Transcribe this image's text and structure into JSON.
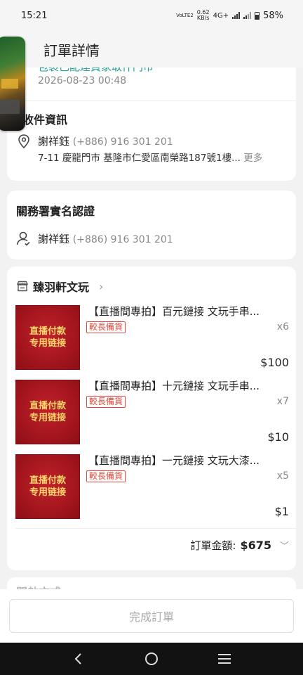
{
  "status_bar": {
    "time": "15:21",
    "speed_top": "0.62",
    "speed_unit": "KB/s",
    "net_small": "VoLTE2",
    "network": "4G+",
    "battery": "58%"
  },
  "header": {
    "title": "訂單詳情"
  },
  "shipping": {
    "status": "包裹已配達買家取件門市",
    "time": "2026-08-23 00:48",
    "section_title": "收件資訊",
    "name": "謝祥鈺",
    "phone": "(+886) 916 301 201",
    "address": "7-11 慶龍門市 基隆市仁愛區南榮路187號1樓...",
    "more": "更多"
  },
  "customs": {
    "title": "關務署實名認證",
    "name": "謝祥鈺",
    "phone": "(+886) 916 301 201"
  },
  "shop": {
    "name": "臻羽軒文玩",
    "items": [
      {
        "thumb_line1": "直播付款",
        "thumb_line2": "专用链接",
        "title": "【直播間專拍】百元鏈接 文玩手串...",
        "tag": "較長備貨",
        "qty": "x6",
        "price": "$100"
      },
      {
        "thumb_line1": "直播付款",
        "thumb_line2": "专用链接",
        "title": "【直播間專拍】十元鏈接 文玩手串...",
        "tag": "較長備貨",
        "qty": "x7",
        "price": "$10"
      },
      {
        "thumb_line1": "直播付款",
        "thumb_line2": "专用链接",
        "title": "【直播間專拍】一元鏈接 文玩大漆...",
        "tag": "較長備貨",
        "qty": "x5",
        "price": "$1"
      }
    ],
    "total_label": "訂單金額:",
    "total_amount": "$675"
  },
  "next_section": {
    "title": "開啟方式"
  },
  "bottom": {
    "complete_label": "完成訂單"
  },
  "colors": {
    "accent_teal": "#1a9c8e",
    "tag_red": "#e0483c",
    "thumb_red": "#a4151d",
    "thumb_gold": "#f7d56b"
  }
}
